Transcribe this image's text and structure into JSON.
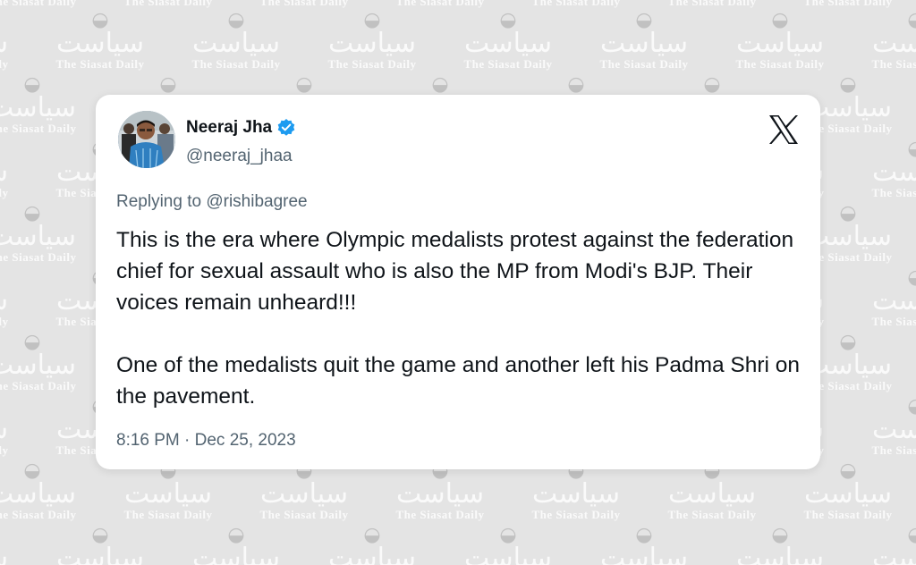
{
  "background": {
    "color": "#e4e4e4",
    "watermark_urdu": "سیاست",
    "watermark_text": "The Siasat Daily",
    "watermark_logo": "siasat-logo-icon"
  },
  "tweet": {
    "author": {
      "display_name": "Neeraj Jha",
      "handle": "@neeraj_jhaa",
      "verified": true,
      "verified_color": "#1d9bf0"
    },
    "platform_logo": "x-logo-icon",
    "reply_to": "Replying to @rishibagree",
    "paragraphs": [
      "This is the era where Olympic medalists protest against the federation chief for sexual assault who is also the MP from Modi's BJP. Their voices remain unheard!!!",
      "One of the medalists quit the game and another left his Padma Shri on the pavement."
    ],
    "timestamp": "8:16 PM · Dec 25, 2023"
  }
}
